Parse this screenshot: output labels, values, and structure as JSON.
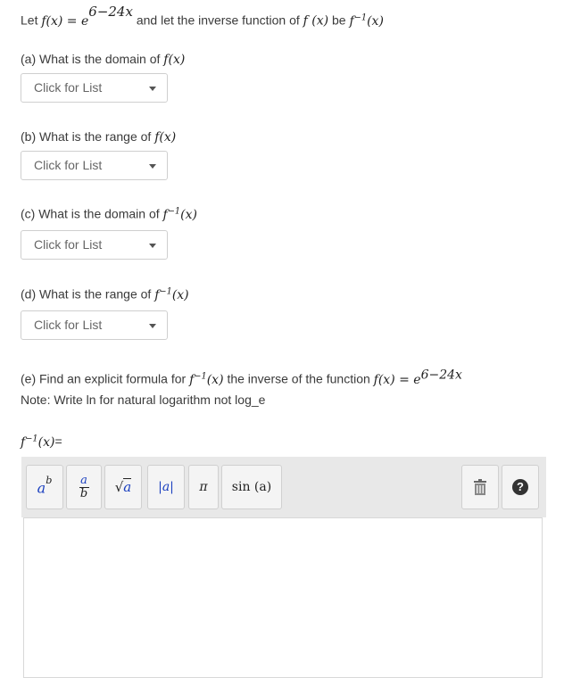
{
  "intro": {
    "prefix": "Let",
    "f_def": "f(x) = e",
    "exp": "6−24x",
    "middle": "and let the inverse function of",
    "fx": "f (x)",
    "be": "be",
    "finv_base": "f",
    "finv_sup": "−1",
    "finv_arg": "(x)"
  },
  "questions": [
    {
      "text": "(a) What is the domain of",
      "math_base": "f(x)",
      "math_sup": "",
      "math_arg": "",
      "select": "Click for List"
    },
    {
      "text": "(b) What is the range of",
      "math_base": "f(x)",
      "math_sup": "",
      "math_arg": "",
      "select": "Click for List"
    },
    {
      "text": "(c) What is the domain of",
      "math_base": "f",
      "math_sup": "−1",
      "math_arg": "(x)",
      "select": "Click for List"
    },
    {
      "text": "(d) What is the range of",
      "math_base": "f",
      "math_sup": "−1",
      "math_arg": "(x)",
      "select": "Click for List"
    }
  ],
  "part_e": {
    "text": "(e) Find an explicit formula for",
    "finv_base": "f",
    "finv_sup": "−1",
    "finv_arg": "(x)",
    "middle": "the inverse of the function",
    "f_def": "f(x) = e",
    "exp": "6−24x",
    "note": "Note: Write ln for natural logarithm not log_e"
  },
  "answer_label": {
    "base": "f",
    "sup": "−1",
    "arg": "(x)",
    "eq": "="
  },
  "toolbar": {
    "power_base": "a",
    "power_exp": "b",
    "frac_num": "a",
    "frac_den": "b",
    "sqrt_arg": "a",
    "abs_label": "|a|",
    "pi_label": "π",
    "sin_label": "sin (a)",
    "help_label": "?"
  }
}
